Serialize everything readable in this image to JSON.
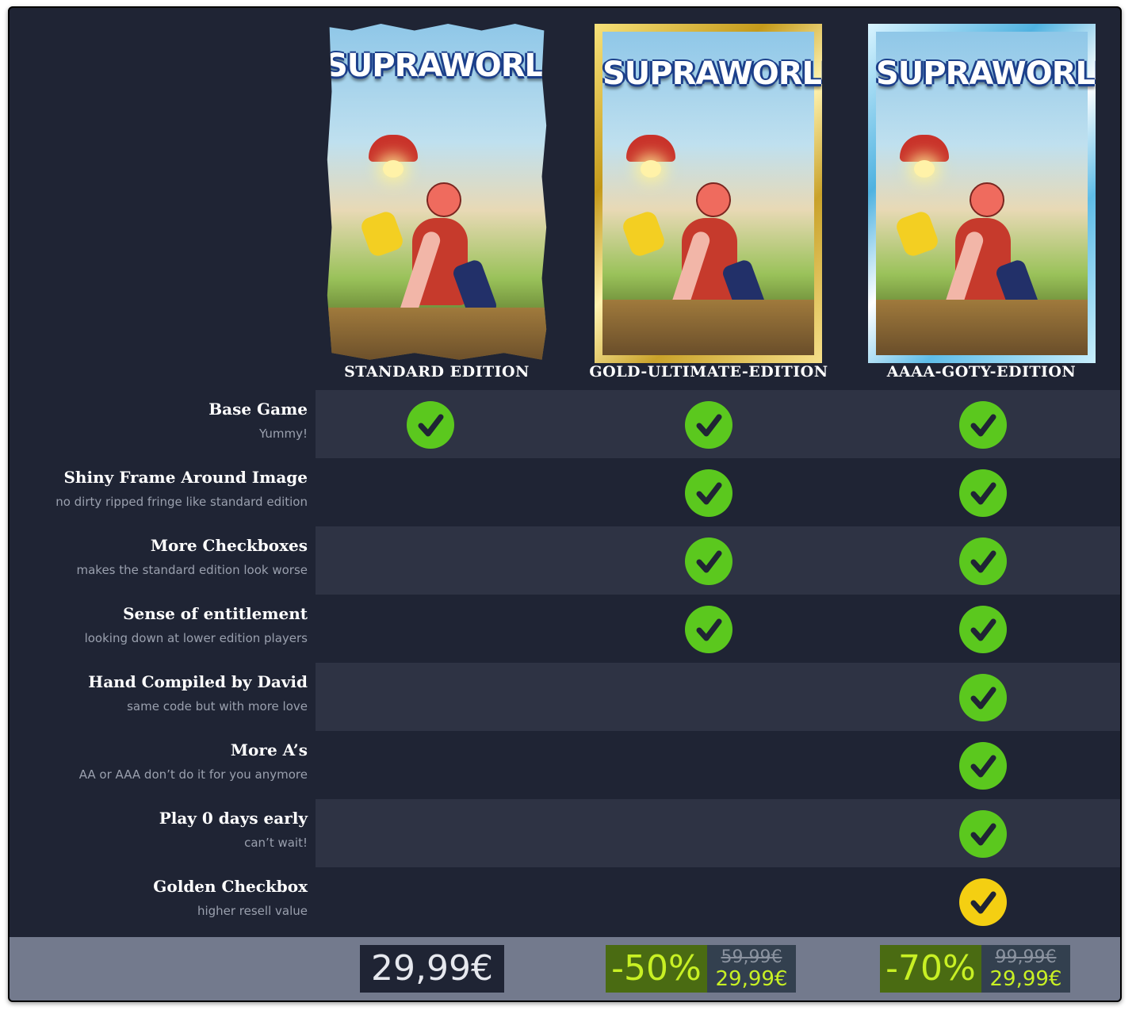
{
  "editions": [
    {
      "title": "STANDARD EDITION",
      "logo": "SUPRAWORLD"
    },
    {
      "title": "GOLD-ULTIMATE-EDITION",
      "logo": "SUPRAWORLD"
    },
    {
      "title": "AAAA-GOTY-EDITION",
      "logo": "SUPRAWORLD"
    }
  ],
  "features": [
    {
      "label": "Base Game",
      "sub": "Yummy!",
      "checks": [
        true,
        true,
        true
      ]
    },
    {
      "label": "Shiny Frame Around Image",
      "sub": "no dirty ripped fringe like standard edition",
      "checks": [
        false,
        true,
        true
      ]
    },
    {
      "label": "More Checkboxes",
      "sub": "makes the standard edition look worse",
      "checks": [
        false,
        true,
        true
      ]
    },
    {
      "label": "Sense of entitlement",
      "sub": "looking down at lower edition players",
      "checks": [
        false,
        true,
        true
      ]
    },
    {
      "label": "Hand Compiled by David",
      "sub": "same code but with more love",
      "checks": [
        false,
        false,
        true
      ]
    },
    {
      "label": "More A’s",
      "sub": "AA or AAA don’t do it for you anymore",
      "checks": [
        false,
        false,
        true
      ]
    },
    {
      "label": "Play 0 days early",
      "sub": "can’t wait!",
      "checks": [
        false,
        false,
        true
      ]
    },
    {
      "label": "Golden Checkbox",
      "sub": "higher resell value",
      "checks": [
        false,
        false,
        "gold"
      ]
    }
  ],
  "prices": {
    "standard": "29,99€",
    "gold": {
      "discount": "-50%",
      "original": "59,99€",
      "final": "29,99€"
    },
    "goty": {
      "discount": "-70%",
      "original": "99,99€",
      "final": "29,99€"
    }
  },
  "colors": {
    "check_green": "#5bc81e",
    "check_gold": "#f4cf12",
    "discount_text": "#c8f024"
  },
  "icons": {
    "check": "check-circle-icon"
  }
}
